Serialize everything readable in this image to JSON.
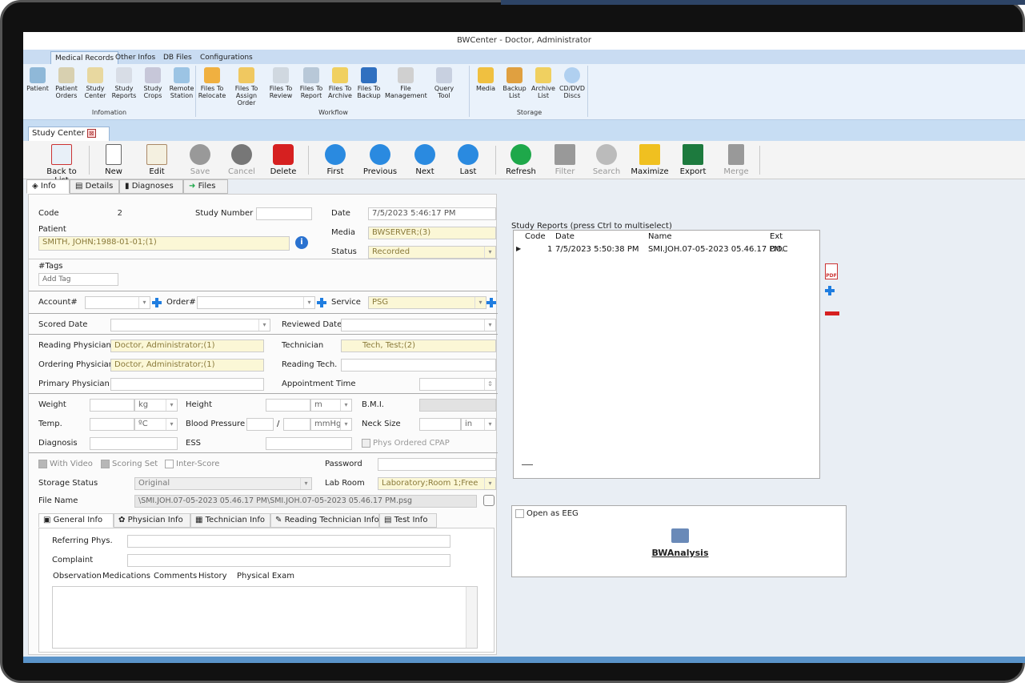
{
  "window": {
    "title": "BWCenter - Doctor, Administrator"
  },
  "menu_tabs": [
    "Medical Records",
    "Other Infos",
    "DB Files",
    "Configurations"
  ],
  "ribbon": {
    "groups": [
      {
        "label": "Infomation",
        "buttons": [
          "Patient",
          "Patient Orders",
          "Study Center",
          "Study Reports",
          "Study Crops",
          "Remote Station"
        ]
      },
      {
        "label": "Workflow",
        "buttons": [
          "Files To Relocate",
          "Files To Assign Order",
          "Files To Review",
          "Files To Report",
          "Files To Archive",
          "Files To Backup",
          "File Management",
          "Query Tool"
        ]
      },
      {
        "label": "Storage",
        "buttons": [
          "Media",
          "Backup List",
          "Archive List",
          "CD/DVD Discs"
        ]
      }
    ]
  },
  "doc_tab": {
    "label": "Study Center",
    "close": "⊠"
  },
  "toolbar": {
    "buttons": [
      "Back to List",
      "New",
      "Edit",
      "Save",
      "Cancel",
      "Delete",
      "First",
      "Previous",
      "Next",
      "Last",
      "Refresh",
      "Filter",
      "Search",
      "Maximize",
      "Export",
      "Merge"
    ]
  },
  "info_tabs": [
    "Info",
    "Details",
    "Diagnoses",
    "Files"
  ],
  "form": {
    "code_label": "Code",
    "code_value": "2",
    "study_number_label": "Study Number",
    "study_number_value": "",
    "date_label": "Date",
    "date_value": "7/5/2023 5:46:17 PM",
    "patient_label": "Patient",
    "patient_value": "SMITH, JOHN;1988-01-01;(1)",
    "media_label": "Media",
    "media_value": "BWSERVER;(3)",
    "status_label": "Status",
    "status_value": "Recorded",
    "tags_label": "#Tags",
    "tags_placeholder": "Add Tag",
    "account_label": "Account#",
    "order_label": "Order#",
    "service_label": "Service",
    "service_value": "PSG",
    "scored_date_label": "Scored Date",
    "reviewed_date_label": "Reviewed Date",
    "reading_physician_label": "Reading Physician",
    "reading_physician_value": "Doctor, Administrator;(1)",
    "technician_label": "Technician",
    "technician_value": "Tech, Test;(2)",
    "ordering_physician_label": "Ordering Physician",
    "ordering_physician_value": "Doctor, Administrator;(1)",
    "reading_tech_label": "Reading Tech.",
    "primary_physician_label": "Primary Physician",
    "appointment_time_label": "Appointment Time",
    "weight_label": "Weight",
    "weight_unit": "kg",
    "height_label": "Height",
    "height_unit": "m",
    "bmi_label": "B.M.I.",
    "temp_label": "Temp.",
    "temp_unit": "ºC",
    "blood_pressure_label": "Blood Pressure",
    "bp_sep": "/",
    "bp_unit": "mmHg",
    "neck_size_label": "Neck Size",
    "neck_unit": "in",
    "diagnosis_label": "Diagnosis",
    "ess_label": "ESS",
    "phys_cpap_label": "Phys Ordered CPAP",
    "with_video_label": "With Video",
    "scoring_set_label": "Scoring Set",
    "inter_score_label": "Inter-Score",
    "password_label": "Password",
    "storage_status_label": "Storage Status",
    "storage_status_value": "Original",
    "lab_room_label": "Lab Room",
    "lab_room_value": "Laboratory;Room 1;Free",
    "file_name_label": "File Name",
    "file_name_value": "\\SMI.JOH.07-05-2023 05.46.17 PM\\SMI.JOH.07-05-2023 05.46.17 PM.psg"
  },
  "sub_tabs": [
    "General Info",
    "Physician Info",
    "Technician Info",
    "Reading Technician Info",
    "Test Info"
  ],
  "general": {
    "referring_label": "Referring Phys.",
    "complaint_label": "Complaint"
  },
  "obs_tabs": [
    "Observation",
    "Medications",
    "Comments",
    "History",
    "Physical Exam"
  ],
  "reports": {
    "title": "Study Reports (press Ctrl to multiselect)",
    "columns": [
      "Code",
      "Date",
      "Name",
      "Ext"
    ],
    "rows": [
      {
        "code": "1",
        "date": "7/5/2023 5:50:38 PM",
        "name": "SMI.JOH.07-05-2023 05.46.17 PM.",
        "ext": "DOC"
      }
    ],
    "pdf_label": "PDF"
  },
  "eeg": {
    "checkbox_label": "Open as EEG",
    "button_label": "BWAnalysis"
  },
  "colors": {
    "accent": "#5a93c9",
    "field_yellow": "#fbf7d6"
  }
}
